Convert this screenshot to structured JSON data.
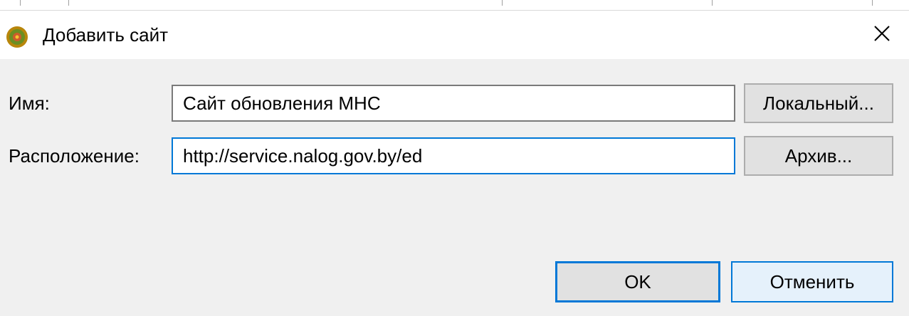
{
  "dialog": {
    "title": "Добавить сайт",
    "icon": "eclipse-app-icon",
    "close_icon": "close-icon"
  },
  "form": {
    "name_label": "Имя:",
    "name_value": "Сайт обновления МНС",
    "location_label": "Расположение:",
    "location_value": "http://service.nalog.gov.by/ed",
    "local_button": "Локальный...",
    "archive_button": "Архив..."
  },
  "actions": {
    "ok_label": "OK",
    "cancel_label": "Отменить"
  },
  "colors": {
    "focus_accent": "#0078d7",
    "dialog_background": "#f0f0f0",
    "title_background": "#ffffff"
  }
}
